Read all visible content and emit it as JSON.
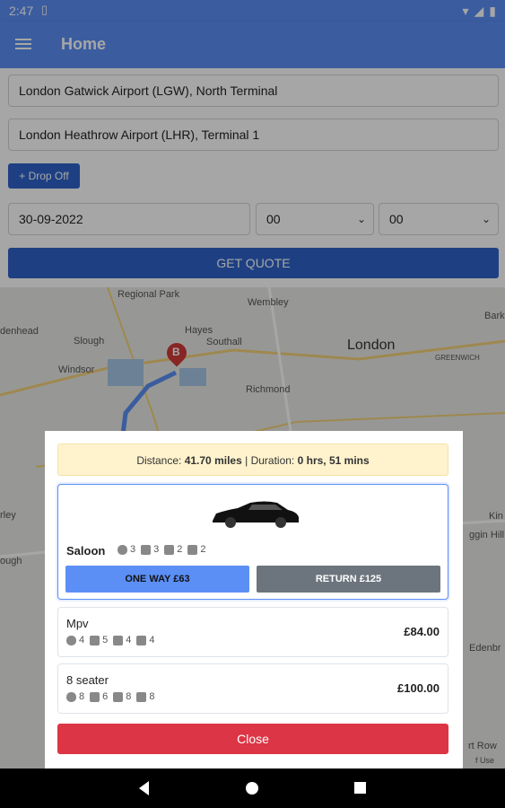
{
  "status_bar": {
    "time": "2:47",
    "sim_icon": "sim-icon"
  },
  "app_bar": {
    "title": "Home"
  },
  "form": {
    "pickup": "London Gatwick Airport (LGW), North Terminal",
    "dropoff": "London Heathrow Airport (LHR), Terminal 1",
    "add_drop_off": "+ Drop Off",
    "date": "30-09-2022",
    "hour": "00",
    "minute": "00",
    "get_quote": "GET QUOTE"
  },
  "map": {
    "labels": [
      "Regional Park",
      "Wembley",
      "denhead",
      "Slough",
      "Hayes",
      "Southall",
      "London",
      "Windsor",
      "Bark",
      "GREENWICH",
      "Richmond",
      "rley",
      "ough",
      "Kin",
      "ggin Hill",
      "Edenbr",
      "rt Row",
      "f Use"
    ],
    "marker": "B"
  },
  "modal": {
    "distance_label": "Distance:",
    "distance_value": "41.70 miles",
    "separator": "|",
    "duration_label": "Duration:",
    "duration_value": "0 hrs, 51 mins",
    "selected": {
      "name": "Saloon",
      "passengers": "3",
      "seats": "3",
      "luggage": "2",
      "hand_luggage": "2",
      "one_way": "ONE WAY £63",
      "return": "RETURN £125"
    },
    "options": [
      {
        "name": "Mpv",
        "passengers": "4",
        "seats": "5",
        "luggage": "4",
        "hand_luggage": "4",
        "price": "£84.00"
      },
      {
        "name": "8 seater",
        "passengers": "8",
        "seats": "6",
        "luggage": "8",
        "hand_luggage": "8",
        "price": "£100.00"
      }
    ],
    "close": "Close"
  },
  "colors": {
    "primary": "#5b8ff5",
    "button": "#2f63c9",
    "danger": "#dc3545",
    "return": "#6c757d",
    "info_bg": "#fff3cd"
  }
}
